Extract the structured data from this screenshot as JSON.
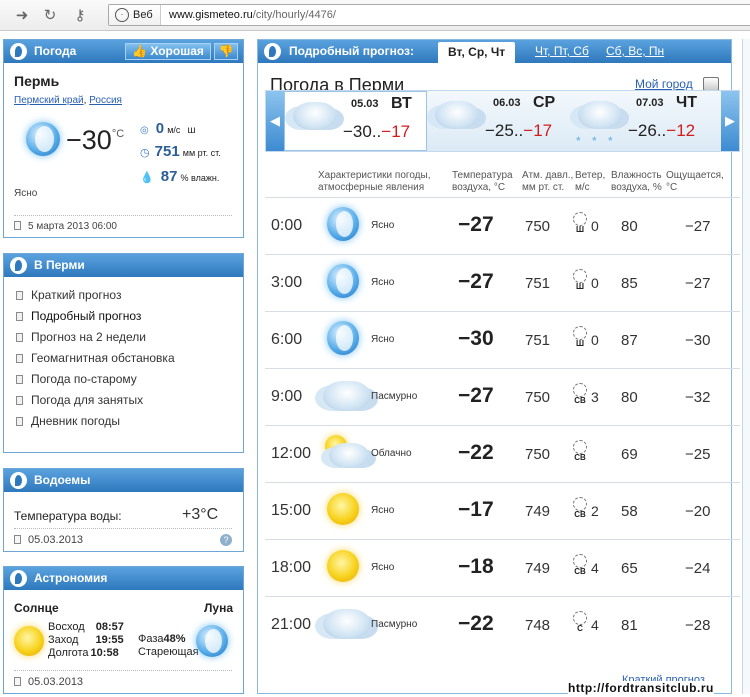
{
  "browser": {
    "site_label": "Веб",
    "url_host": "www.gismeteo.ru",
    "url_path": "/city/hourly/4476/"
  },
  "weather": {
    "header": "Погода",
    "mood": "Хорошая",
    "city": "Пермь",
    "region": "Пермский край",
    "sep": ",",
    "country": "Россия",
    "temp": "−30",
    "unit": "°C",
    "wind_val": "0",
    "wind_unit": "м/с",
    "wind_dir": "ш",
    "pressure_val": "751",
    "pressure_unit": "мм рт. ст.",
    "humidity_val": "87",
    "humidity_unit": "% влажн.",
    "condition": "Ясно",
    "date": "5 марта 2013 06:00"
  },
  "in_city": {
    "header": "В Перми",
    "items": [
      "Краткий прогноз",
      "Подробный прогноз",
      "Прогноз на 2 недели",
      "Геомагнитная обстановка",
      "Погода по-старому",
      "Погода для занятых",
      "Дневник погоды"
    ]
  },
  "water": {
    "header": "Водоемы",
    "label": "Температура воды:",
    "value": "+3°C",
    "date": "05.03.2013"
  },
  "astro": {
    "header": "Астрономия",
    "sun_label": "Солнце",
    "moon_label": "Луна",
    "rise_label": "Восход",
    "rise": "08:57",
    "set_label": "Заход",
    "set": "19:55",
    "length_label": "Долгота",
    "length": "10:58",
    "phase_label": "Фаза",
    "phase": "48%",
    "phase_name": "Стареющая",
    "date": "05.03.2013"
  },
  "forecast": {
    "header": "Подробный прогноз:",
    "tabs": [
      "Вт, Ср, Чт",
      "Чт, Пт, Сб",
      "Сб, Вс, Пн"
    ],
    "title": "Погода в Перми",
    "my_city": "Мой город",
    "days": [
      {
        "date": "05.03",
        "dow": "ВТ",
        "tmin": "−30..",
        "tmax": "−17"
      },
      {
        "date": "06.03",
        "dow": "СР",
        "tmin": "−25..",
        "tmax": "−17"
      },
      {
        "date": "07.03",
        "dow": "ЧТ",
        "tmin": "−26..",
        "tmax": "−12",
        "snow": "* * *"
      }
    ],
    "columns": {
      "cond1": "Характеристики погоды,",
      "cond2": "атмосферные явления",
      "temp1": "Температура",
      "temp2": "воздуха, °С",
      "press1": "Атм. давл.,",
      "press2": "мм рт. ст.",
      "wind1": "Ветер,",
      "wind2": "м/с",
      "hum1": "Влажность",
      "hum2": "воздуха, %",
      "feel1": "Ощущается,",
      "feel2": "°С"
    },
    "rows": [
      {
        "time": "0:00",
        "icon": "moon-icon",
        "cond": "Ясно",
        "temp": "−27",
        "press": "750",
        "dir": "Ш",
        "wind": "0",
        "hum": "80",
        "feel": "−27"
      },
      {
        "time": "3:00",
        "icon": "moon-icon",
        "cond": "Ясно",
        "temp": "−27",
        "press": "751",
        "dir": "Ш",
        "wind": "0",
        "hum": "85",
        "feel": "−27"
      },
      {
        "time": "6:00",
        "icon": "moon-icon",
        "cond": "Ясно",
        "temp": "−30",
        "press": "751",
        "dir": "Ш",
        "wind": "0",
        "hum": "87",
        "feel": "−30"
      },
      {
        "time": "9:00",
        "icon": "cloud-icon",
        "cond": "Пасмурно",
        "temp": "−27",
        "press": "750",
        "dir": "СВ",
        "wind": "3",
        "hum": "80",
        "feel": "−32"
      },
      {
        "time": "12:00",
        "icon": "sun-cloud-icon",
        "cond": "Облачно",
        "temp": "−22",
        "press": "750",
        "dir": "СВ",
        "wind": "",
        "hum": "69",
        "feel": "−25"
      },
      {
        "time": "15:00",
        "icon": "sun-icon",
        "cond": "Ясно",
        "temp": "−17",
        "press": "749",
        "dir": "СВ",
        "wind": "2",
        "hum": "58",
        "feel": "−20"
      },
      {
        "time": "18:00",
        "icon": "sun-icon",
        "cond": "Ясно",
        "temp": "−18",
        "press": "749",
        "dir": "СВ",
        "wind": "4",
        "hum": "65",
        "feel": "−24"
      },
      {
        "time": "21:00",
        "icon": "cloud-icon",
        "cond": "Пасмурно",
        "temp": "−22",
        "press": "748",
        "dir": "С",
        "wind": "4",
        "hum": "81",
        "feel": "−28"
      }
    ],
    "short_link": "Краткий прогноз"
  },
  "watermark": "http://fordtransitclub.ru",
  "colors": {
    "accent": "#2e78bd",
    "link": "#2a60b2",
    "hot": "#d11c1c"
  }
}
